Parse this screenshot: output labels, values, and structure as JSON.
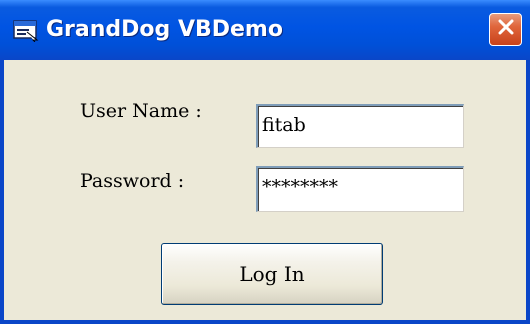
{
  "window": {
    "title": "GrandDog VBDemo",
    "icon": "app-window-icon",
    "close_icon": "close-icon"
  },
  "form": {
    "username_label": "User Name :",
    "username_value": "fitab",
    "password_label": "Password :",
    "password_value": "********",
    "login_label": "Log In"
  },
  "colors": {
    "titlebar": "#0054E3",
    "close_button": "#E0663C",
    "dialog_background": "#ECE9D8"
  }
}
